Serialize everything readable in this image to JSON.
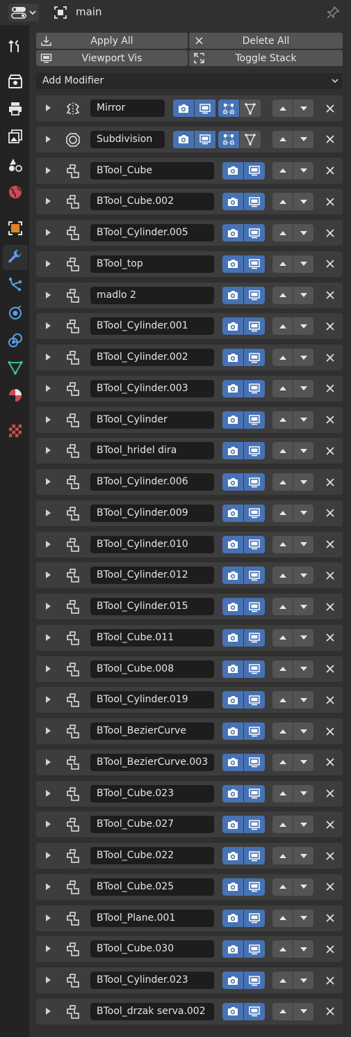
{
  "header": {
    "context_name": "main"
  },
  "tabs": [
    {
      "name": "tool-tab",
      "icon": "tool-icon",
      "active": false
    },
    {
      "name": "render-tab",
      "icon": "render-icon",
      "active": false
    },
    {
      "name": "output-tab",
      "icon": "output-icon",
      "active": false
    },
    {
      "name": "view-layer-tab",
      "icon": "view-layer-icon",
      "active": false
    },
    {
      "name": "scene-tab",
      "icon": "scene-icon",
      "active": false
    },
    {
      "name": "world-tab",
      "icon": "world-icon",
      "active": false
    },
    {
      "name": "object-tab",
      "icon": "object-icon",
      "active": false
    },
    {
      "name": "modifiers-tab",
      "icon": "wrench-icon",
      "active": true
    },
    {
      "name": "particles-tab",
      "icon": "particles-icon",
      "active": false
    },
    {
      "name": "physics-tab",
      "icon": "physics-icon",
      "active": false
    },
    {
      "name": "constraints-tab",
      "icon": "constraints-icon",
      "active": false
    },
    {
      "name": "data-tab",
      "icon": "mesh-data-icon",
      "active": false
    },
    {
      "name": "material-tab",
      "icon": "material-icon",
      "active": false
    },
    {
      "name": "texture-tab",
      "icon": "texture-icon",
      "active": false
    }
  ],
  "toolbar": {
    "apply_all": "Apply All",
    "delete_all": "Delete All",
    "viewport_vis": "Viewport Vis",
    "toggle_stack": "Toggle Stack"
  },
  "add_modifier_label": "Add Modifier",
  "modifiers": [
    {
      "name": "Mirror",
      "type": "mirror",
      "editmode": true,
      "cage": true
    },
    {
      "name": "Subdivision",
      "type": "subdivision",
      "editmode": true,
      "cage": true
    },
    {
      "name": "BTool_Cube",
      "type": "boolean"
    },
    {
      "name": "BTool_Cube.002",
      "type": "boolean"
    },
    {
      "name": "BTool_Cylinder.005",
      "type": "boolean"
    },
    {
      "name": "BTool_top",
      "type": "boolean"
    },
    {
      "name": "madlo 2",
      "type": "boolean"
    },
    {
      "name": "BTool_Cylinder.001",
      "type": "boolean"
    },
    {
      "name": "BTool_Cylinder.002",
      "type": "boolean"
    },
    {
      "name": "BTool_Cylinder.003",
      "type": "boolean"
    },
    {
      "name": "BTool_Cylinder",
      "type": "boolean"
    },
    {
      "name": "BTool_hridel dira",
      "type": "boolean"
    },
    {
      "name": "BTool_Cylinder.006",
      "type": "boolean"
    },
    {
      "name": "BTool_Cylinder.009",
      "type": "boolean"
    },
    {
      "name": "BTool_Cylinder.010",
      "type": "boolean"
    },
    {
      "name": "BTool_Cylinder.012",
      "type": "boolean"
    },
    {
      "name": "BTool_Cylinder.015",
      "type": "boolean"
    },
    {
      "name": "BTool_Cube.011",
      "type": "boolean"
    },
    {
      "name": "BTool_Cube.008",
      "type": "boolean"
    },
    {
      "name": "BTool_Cylinder.019",
      "type": "boolean"
    },
    {
      "name": "BTool_BezierCurve",
      "type": "boolean"
    },
    {
      "name": "BTool_BezierCurve.003",
      "type": "boolean"
    },
    {
      "name": "BTool_Cube.023",
      "type": "boolean"
    },
    {
      "name": "BTool_Cube.027",
      "type": "boolean"
    },
    {
      "name": "BTool_Cube.022",
      "type": "boolean"
    },
    {
      "name": "BTool_Cube.025",
      "type": "boolean"
    },
    {
      "name": "BTool_Plane.001",
      "type": "boolean"
    },
    {
      "name": "BTool_Cube.030",
      "type": "boolean"
    },
    {
      "name": "BTool_Cylinder.023",
      "type": "boolean"
    },
    {
      "name": "BTool_drzak serva.002",
      "type": "boolean"
    }
  ],
  "colors": {
    "accent": "#4772b3",
    "panel": "#3d3d3d",
    "background": "#303030",
    "tabbar": "#232323"
  }
}
